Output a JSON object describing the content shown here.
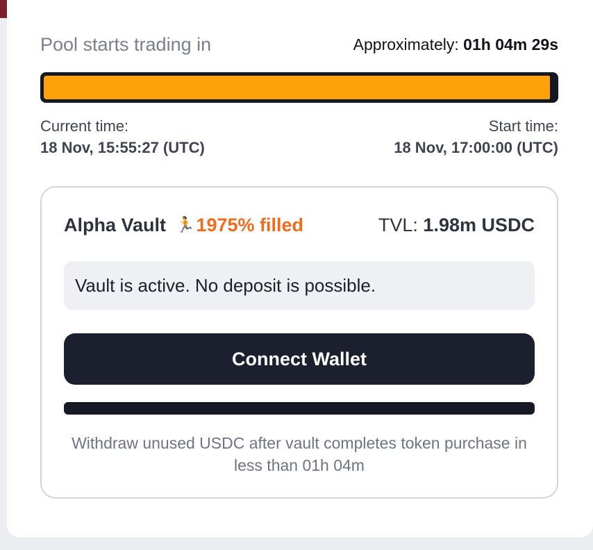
{
  "header": {
    "pool_label": "Pool starts trading in",
    "approx_label": "Approximately:",
    "countdown": "01h 04m 29s"
  },
  "progress": {
    "fraction": 0.99,
    "fill_color": "#ffa20a",
    "track_color": "#141823"
  },
  "times": {
    "current_label": "Current time:",
    "current_value": "18 Nov, 15:55:27 (UTC)",
    "start_label": "Start time:",
    "start_value": "18 Nov, 17:00:00 (UTC)"
  },
  "vault": {
    "name": "Alpha Vault",
    "icon": "runner-icon",
    "filled_text": "1975% filled",
    "tvl_label": "TVL:",
    "tvl_value": "1.98m USDC",
    "status_message": "Vault is active. No deposit is possible.",
    "connect_label": "Connect Wallet",
    "withdraw_note": "Withdraw unused USDC after vault completes token purchase in less than 01h 04m"
  },
  "colors": {
    "accent_orange": "#f26b1d",
    "button_dark": "#1c1f2e"
  }
}
